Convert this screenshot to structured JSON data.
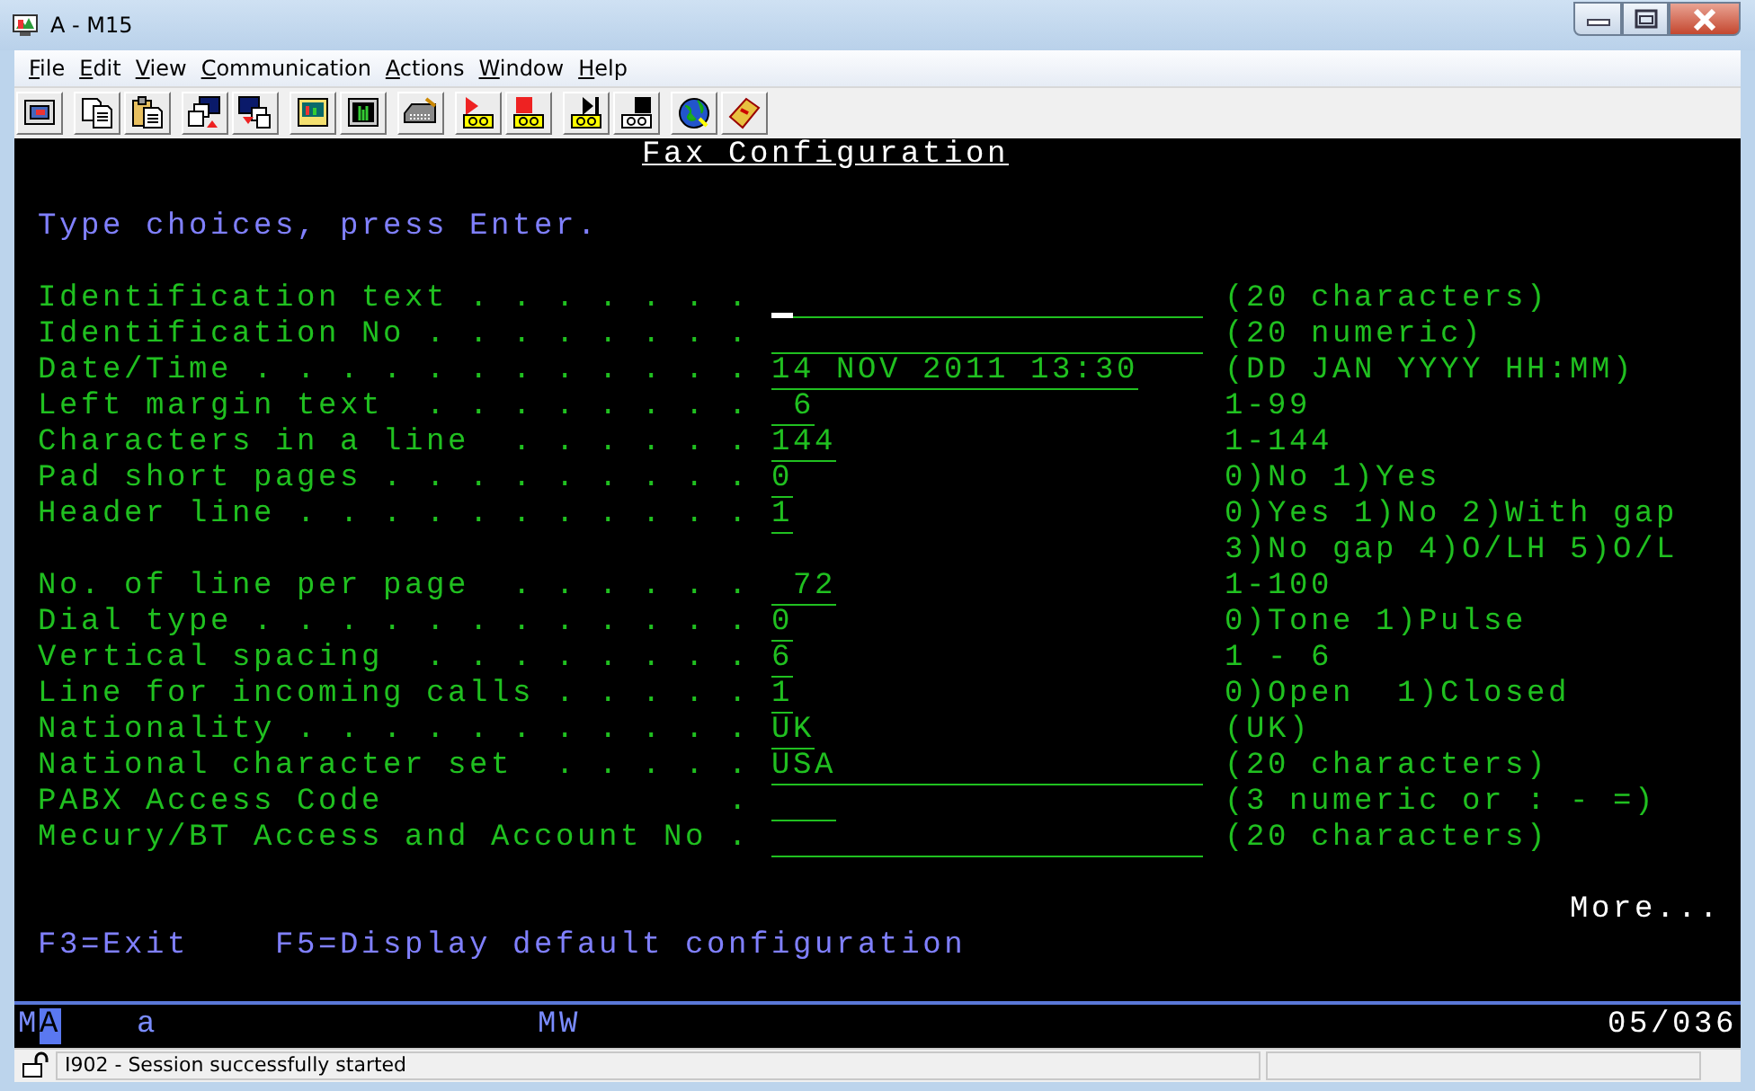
{
  "window": {
    "title": "A - M15"
  },
  "menu": [
    "File",
    "Edit",
    "View",
    "Communication",
    "Actions",
    "Window",
    "Help"
  ],
  "screen": {
    "title": "Fax Configuration",
    "instruction": "Type choices, press Enter.",
    "fields": [
      {
        "label": "Identification text . . . . . . .",
        "kind": "text20",
        "cursor": true,
        "hint": "(20 characters)"
      },
      {
        "label": "Identification No . . . . . . . .",
        "kind": "text20",
        "cursor": false,
        "hint": "(20 numeric)"
      },
      {
        "label": "Date/Time . . . . . . . . . . . .",
        "value": "14 NOV 2011 13:30",
        "kind": "fit",
        "cursor": false,
        "hint": "(DD JAN YYYY HH:MM)"
      },
      {
        "label": "Left margin text  . . . . . . . .",
        "value": " 6",
        "kind": "fit",
        "cursor": false,
        "hint": "1-99"
      },
      {
        "label": "Characters in a line  . . . . . .",
        "value": "144",
        "kind": "fit",
        "cursor": false,
        "hint": "1-144"
      },
      {
        "label": "Pad short pages . . . . . . . . .",
        "value": "0",
        "kind": "fit",
        "cursor": false,
        "hint": "0)No 1)Yes"
      },
      {
        "label": "Header line . . . . . . . . . . .",
        "value": "1",
        "kind": "fit",
        "cursor": false,
        "hint": "0)Yes 1)No 2)With gap",
        "hint_more": "3)No gap 4)O/LH 5)O/L"
      },
      {
        "label": "No. of line per page  . . . . . .",
        "value": " 72",
        "kind": "fit",
        "cursor": false,
        "hint": "1-100"
      },
      {
        "label": "Dial type . . . . . . . . . . . .",
        "value": "0",
        "kind": "fit",
        "cursor": false,
        "hint": "0)Tone 1)Pulse"
      },
      {
        "label": "Vertical spacing  . . . . . . . .",
        "value": "6",
        "kind": "fit",
        "cursor": false,
        "hint": "1 - 6"
      },
      {
        "label": "Line for incoming calls . . . . .",
        "value": "1",
        "kind": "fit",
        "cursor": false,
        "hint": "0)Open  1)Closed"
      },
      {
        "label": "Nationality . . . . . . . . . . .",
        "value": "UK",
        "kind": "fit",
        "cursor": false,
        "hint": "(UK)"
      },
      {
        "label": "National character set  . . . . .",
        "value": "USA",
        "kind": "text20",
        "cursor": false,
        "hint": "(20 characters)"
      },
      {
        "label": "PABX Access Code                .",
        "kind": "text3",
        "cursor": false,
        "hint": "(3 numeric or : - =)"
      },
      {
        "label": "Mecury/BT Access and Account No .",
        "kind": "text20",
        "cursor": false,
        "hint": "(20 characters)"
      }
    ],
    "more": "More...",
    "function_keys": [
      "F3=Exit",
      "F5=Display default configuration"
    ]
  },
  "oia": {
    "indicators": [
      {
        "text": "M",
        "selected": false
      },
      {
        "text": "A",
        "selected": true
      }
    ],
    "shift": "a",
    "mode": "MW",
    "cursor_position": "05/036"
  },
  "status_bar": {
    "message": "I902 - Session successfully started"
  }
}
